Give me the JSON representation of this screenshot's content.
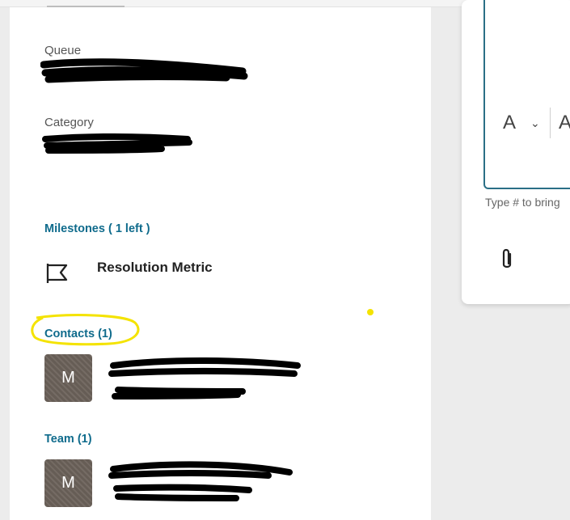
{
  "details": {
    "queue_label": "Queue",
    "category_label": "Category"
  },
  "milestones": {
    "heading": "Milestones ( 1 left )",
    "item_label": "Resolution Metric"
  },
  "contacts": {
    "heading": "Contacts (1)",
    "avatar_initial": "M"
  },
  "team": {
    "heading": "Team (1)",
    "avatar_initial": "M"
  },
  "editor": {
    "font_button": "A",
    "font_button_2": "A",
    "hint": "Type # to bring"
  },
  "colors": {
    "accent": "#0f6b8c",
    "editor_border": "#2a6f86",
    "highlight": "#f4e300"
  }
}
